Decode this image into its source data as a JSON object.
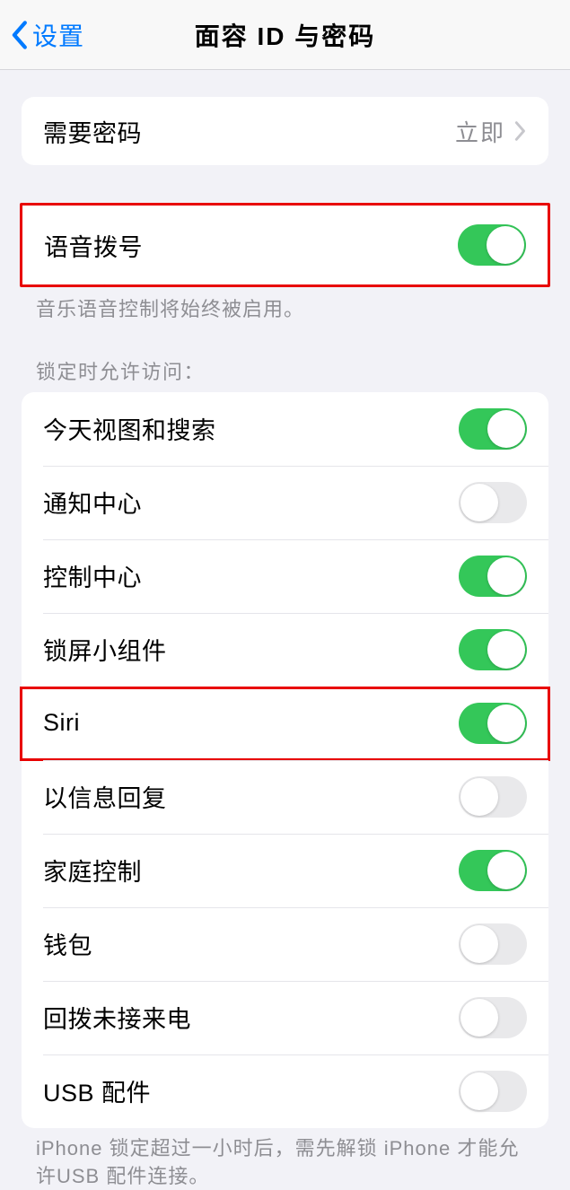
{
  "nav": {
    "back": "设置",
    "title": "面容 ID 与密码"
  },
  "passcode": {
    "label": "需要密码",
    "value": "立即"
  },
  "voice_dial": {
    "label": "语音拨号",
    "on": true
  },
  "voice_footer": "音乐语音控制将始终被启用。",
  "lock_header": "锁定时允许访问：",
  "lock_items": [
    {
      "label": "今天视图和搜索",
      "on": true
    },
    {
      "label": "通知中心",
      "on": false
    },
    {
      "label": "控制中心",
      "on": true
    },
    {
      "label": "锁屏小组件",
      "on": true
    },
    {
      "label": "Siri",
      "on": true
    },
    {
      "label": "以信息回复",
      "on": false
    },
    {
      "label": "家庭控制",
      "on": true
    },
    {
      "label": "钱包",
      "on": false
    },
    {
      "label": "回拨未接来电",
      "on": false
    },
    {
      "label": "USB 配件",
      "on": false
    }
  ],
  "usb_footer": "iPhone 锁定超过一小时后，需先解锁 iPhone 才能允许USB 配件连接。"
}
